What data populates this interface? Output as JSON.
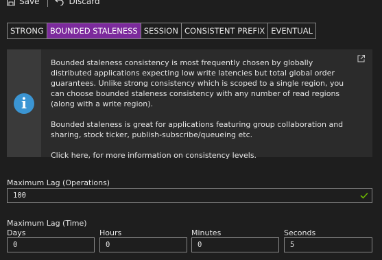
{
  "toolbar": {
    "save_label": "Save",
    "discard_label": "Discard"
  },
  "consistency": {
    "options": [
      "STRONG",
      "BOUNDED STALENESS",
      "SESSION",
      "CONSISTENT PREFIX",
      "EVENTUAL"
    ],
    "selected": "BOUNDED STALENESS"
  },
  "info": {
    "paragraph1": "Bounded staleness consistency is most frequently chosen by globally distributed applications expecting low write latencies but total global order guarantees. Unlike strong consistency which is scoped to a single region, you can choose bounded staleness consistency with any number of read regions (along with a write region).",
    "paragraph2": "Bounded staleness is great for applications featuring group collaboration and sharing, stock ticker, publish-subscribe/queueing etc.",
    "link_text": "Click here, for more information on consistency levels."
  },
  "max_lag_operations": {
    "label": "Maximum Lag (Operations)",
    "value": "100"
  },
  "max_lag_time": {
    "label": "Maximum Lag (Time)",
    "days": {
      "label": "Days",
      "value": "0"
    },
    "hours": {
      "label": "Hours",
      "value": "0"
    },
    "minutes": {
      "label": "Minutes",
      "value": "0"
    },
    "seconds": {
      "label": "Seconds",
      "value": "5"
    }
  },
  "colors": {
    "accent": "#7c2a9c",
    "info_icon": "#3b95d3",
    "valid_check": "#6bb700"
  }
}
